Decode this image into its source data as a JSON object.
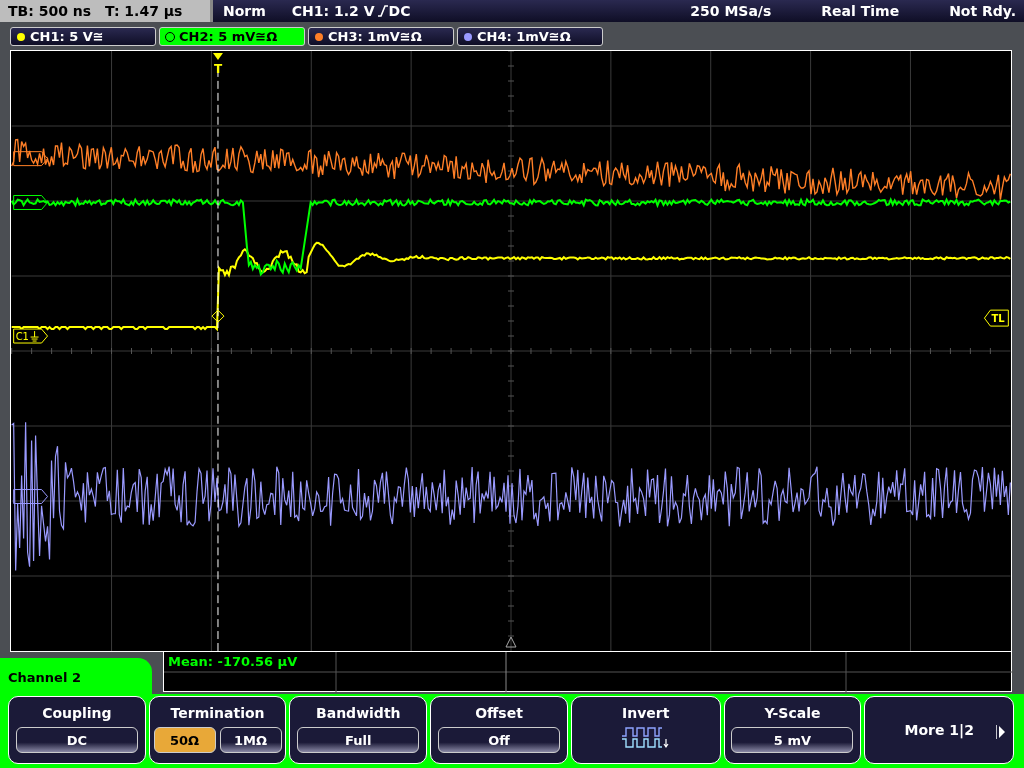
{
  "status_bar": {
    "timebase": "TB: 500 ns",
    "trigger_time": "T: 1.47 µs",
    "trigger_mode": "Norm",
    "trigger_source": "CH1: 1.2 V",
    "trigger_coupling": "DC",
    "sample_rate": "250 MSa/s",
    "acquisition": "Real Time",
    "state": "Not Rdy."
  },
  "channels": [
    {
      "label": "CH1: 5 V≅",
      "color": "#ffff00",
      "selected": false
    },
    {
      "label": "CH2: 5 mV≅Ω",
      "color": "#00ff00",
      "selected": true
    },
    {
      "label": "CH3: 1mV≅Ω",
      "color": "#ff7f27",
      "selected": false
    },
    {
      "label": "CH4: 1mV≅Ω",
      "color": "#9a9aff",
      "selected": false
    }
  ],
  "plot": {
    "trigger_marker": "T",
    "channel_marker": "C1",
    "level_marker": "TL"
  },
  "measurement": {
    "text": "Mean: -170.56 µV"
  },
  "menu": {
    "title": "Channel 2",
    "softkeys": [
      {
        "kind": "value",
        "label": "Coupling",
        "value": "DC"
      },
      {
        "kind": "toggle",
        "label": "Termination",
        "options": [
          {
            "label": "50Ω",
            "selected": true
          },
          {
            "label": "1MΩ",
            "selected": false
          }
        ]
      },
      {
        "kind": "value",
        "label": "Bandwidth",
        "value": "Full"
      },
      {
        "kind": "value",
        "label": "Offset",
        "value": "Off"
      },
      {
        "kind": "icon",
        "label": "Invert"
      },
      {
        "kind": "value",
        "label": "Y-Scale",
        "value": "5 mV"
      },
      {
        "kind": "more",
        "label": "More 1|2"
      }
    ]
  }
}
